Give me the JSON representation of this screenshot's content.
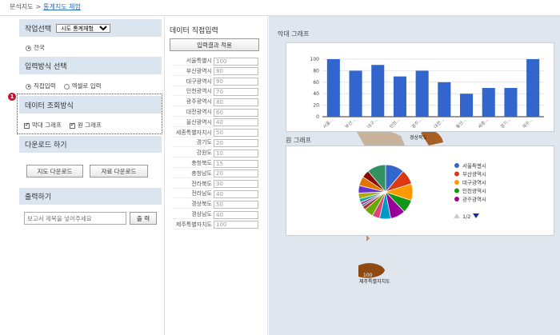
{
  "breadcrumb": {
    "root": "분석지도",
    "sep": ">",
    "current": "통계지도 체험"
  },
  "left": {
    "work_select": {
      "title": "작업선택",
      "combo_value": "시도 통계체험",
      "radio_label": "전국"
    },
    "input_mode": {
      "title": "입력방식 선택",
      "option1": "직접입력",
      "option2": "엑셀로 입력"
    },
    "query_mode": {
      "badge": "1",
      "title": "데이터 조회방식",
      "check1": "막대 그래프",
      "check2": "원 그래프"
    },
    "download": {
      "title": "다운로드 하기",
      "btn_map": "지도 다운로드",
      "btn_data": "자료 다운로드"
    },
    "output": {
      "title": "출력하기",
      "placeholder": "보고서 제목을 넣어주세요",
      "btn_print": "출 력"
    }
  },
  "middle": {
    "title": "데이터 직접입력",
    "apply_button": "입력결과 적용",
    "rows": [
      {
        "label": "서울특별시",
        "value": "100"
      },
      {
        "label": "부산광역시",
        "value": "80"
      },
      {
        "label": "대구광역시",
        "value": "90"
      },
      {
        "label": "인천광역시",
        "value": "70"
      },
      {
        "label": "광주광역시",
        "value": "80"
      },
      {
        "label": "대전광역시",
        "value": "60"
      },
      {
        "label": "울산광역시",
        "value": "40"
      },
      {
        "label": "세종특별자치시",
        "value": "50"
      },
      {
        "label": "경기도",
        "value": "20"
      },
      {
        "label": "강원도",
        "value": "10"
      },
      {
        "label": "충청북도",
        "value": "15"
      },
      {
        "label": "충청남도",
        "value": "20"
      },
      {
        "label": "전라북도",
        "value": "30"
      },
      {
        "label": "전라남도",
        "value": "40"
      },
      {
        "label": "경상북도",
        "value": "50"
      },
      {
        "label": "경상남도",
        "value": "40"
      },
      {
        "label": "제주특별자치도",
        "value": "100"
      }
    ]
  },
  "map_labels": {
    "region1": "경상북도",
    "jeju_value": "100",
    "jeju_label": "제주특별자치도"
  },
  "bar_panel": {
    "title": "막대 그래프",
    "yticks": [
      "0",
      "20",
      "40",
      "60",
      "80",
      "100"
    ],
    "xlabels": [
      "서울...",
      "부산...",
      "대구...",
      "인천...",
      "광주...",
      "대전...",
      "울산...",
      "세종...",
      "경기...",
      "제주..."
    ]
  },
  "pie_panel": {
    "title": "원 그래프",
    "legend": [
      {
        "name": "서울특별시",
        "color": "#3366cc"
      },
      {
        "name": "부산광역시",
        "color": "#dc3912"
      },
      {
        "name": "대구광역시",
        "color": "#ff9900"
      },
      {
        "name": "인천광역시",
        "color": "#109618"
      },
      {
        "name": "광주광역시",
        "color": "#990099"
      }
    ],
    "pager": "1/2"
  },
  "chart_data": [
    {
      "type": "bar",
      "categories": [
        "서울특별시",
        "부산광역시",
        "대구광역시",
        "인천광역시",
        "광주광역시",
        "대전광역시",
        "울산광역시",
        "세종특별자치시",
        "경기도",
        "제주특별자치도"
      ],
      "values": [
        100,
        80,
        90,
        70,
        80,
        60,
        40,
        50,
        50,
        100
      ],
      "ylim": [
        0,
        100
      ],
      "color": "#3366cc"
    },
    {
      "type": "pie",
      "categories": [
        "서울특별시",
        "부산광역시",
        "대구광역시",
        "인천광역시",
        "광주광역시",
        "대전광역시",
        "울산광역시",
        "세종특별자치시",
        "경기도",
        "강원도",
        "충청북도",
        "충청남도",
        "전라북도",
        "전라남도",
        "경상북도",
        "경상남도",
        "제주특별자치도"
      ],
      "values": [
        100,
        80,
        90,
        70,
        80,
        60,
        40,
        50,
        20,
        10,
        15,
        20,
        30,
        40,
        50,
        40,
        100
      ],
      "colors": [
        "#3366cc",
        "#dc3912",
        "#ff9900",
        "#109618",
        "#990099",
        "#0099c6",
        "#dd4477",
        "#66aa00",
        "#b82e2e",
        "#316395",
        "#994499",
        "#22aa99",
        "#aaaa11",
        "#6633cc",
        "#e67300",
        "#8b0707",
        "#329262"
      ]
    }
  ]
}
